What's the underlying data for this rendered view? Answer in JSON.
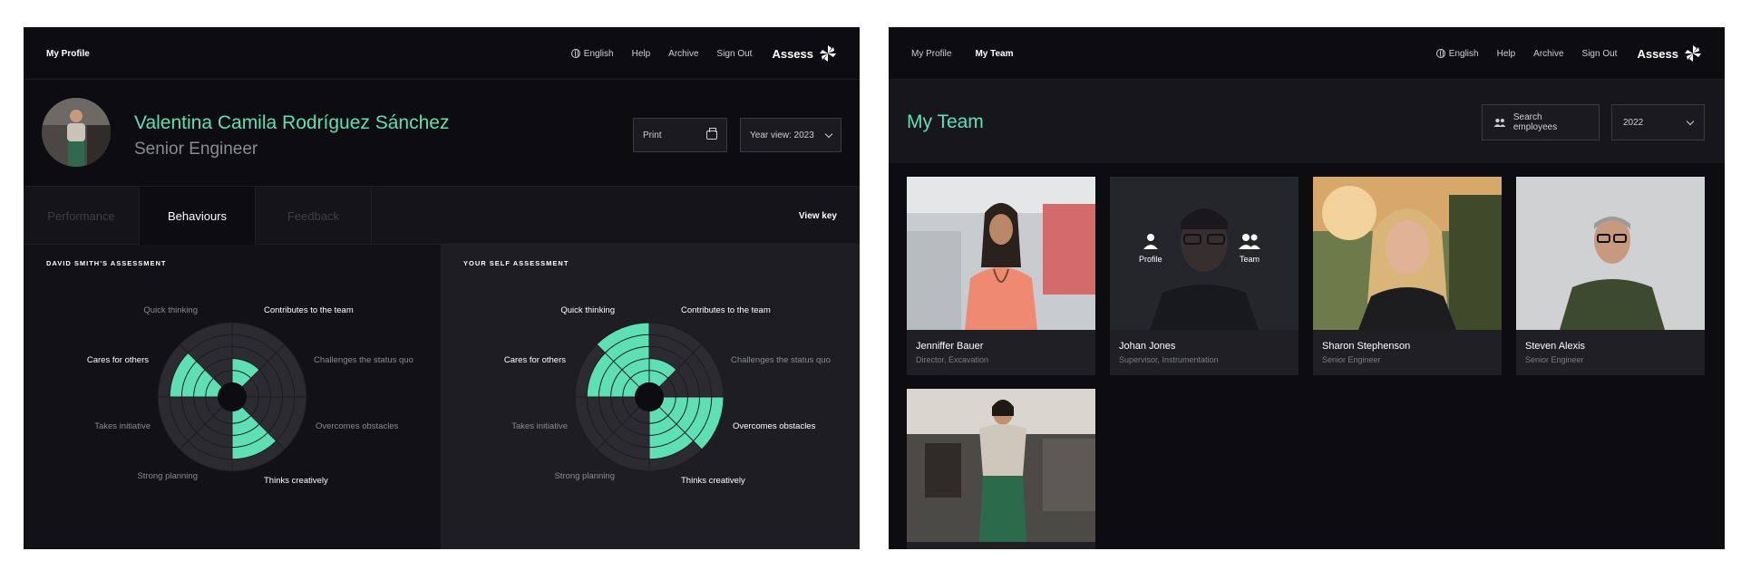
{
  "left_panel": {
    "nav": {
      "my_profile": "My Profile"
    },
    "nav_right": {
      "language": "English",
      "help": "Help",
      "archive": "Archive",
      "sign_out": "Sign Out",
      "logo": "Assess"
    },
    "profile": {
      "name": "Valentina Camila Rodríguez Sánchez",
      "role": "Senior Engineer"
    },
    "print_label": "Print",
    "year_view_label": "Year view: 2023",
    "tabs": [
      {
        "label": "Performance",
        "active": false
      },
      {
        "label": "Behaviours",
        "active": true
      },
      {
        "label": "Feedback",
        "active": false
      }
    ],
    "view_key": "View key",
    "assessments": [
      {
        "title": "DAVID SMITH'S ASSESSMENT",
        "labels": [
          "Contributes to the team",
          "Challenges the status quo",
          "Overcomes obstacles",
          "Thinks creatively",
          "Strong planning",
          "Takes initiative",
          "Cares for others",
          "Quick thinking"
        ],
        "values": [
          2,
          0,
          0,
          4,
          0,
          0,
          4,
          0
        ]
      },
      {
        "title": "YOUR SELF ASSESSMENT",
        "labels": [
          "Contributes to the team",
          "Challenges the status quo",
          "Overcomes obstacles",
          "Thinks creatively",
          "Strong planning",
          "Takes initiative",
          "Cares for others",
          "Quick thinking"
        ],
        "values": [
          2,
          0,
          5,
          4,
          0,
          0,
          4,
          5
        ]
      }
    ]
  },
  "right_panel": {
    "nav": {
      "my_profile": "My Profile",
      "my_team": "My Team"
    },
    "nav_right": {
      "language": "English",
      "help": "Help",
      "archive": "Archive",
      "sign_out": "Sign Out",
      "logo": "Assess"
    },
    "title": "My Team",
    "search_label": "Search employees",
    "year": "2022",
    "overlay": {
      "profile": "Profile",
      "team": "Team"
    },
    "members": [
      {
        "name": "Jenniffer Bauer",
        "role": "Director, Excavation"
      },
      {
        "name": "Johan Jones",
        "role": "Supervisor, Instrumentation"
      },
      {
        "name": "Sharon Stephenson",
        "role": "Senior Engineer"
      },
      {
        "name": "Steven Alexis",
        "role": "Senior Engineer"
      },
      {
        "name": "",
        "role": ""
      }
    ]
  },
  "colors": {
    "accent": "#5ee0b4",
    "bg": "#0c0c11",
    "ring": "#2b2b31"
  },
  "icons": [
    "globe-icon",
    "assess-logo-icon",
    "printer-icon",
    "chevron-down-icon",
    "people-icon",
    "person-icon"
  ]
}
